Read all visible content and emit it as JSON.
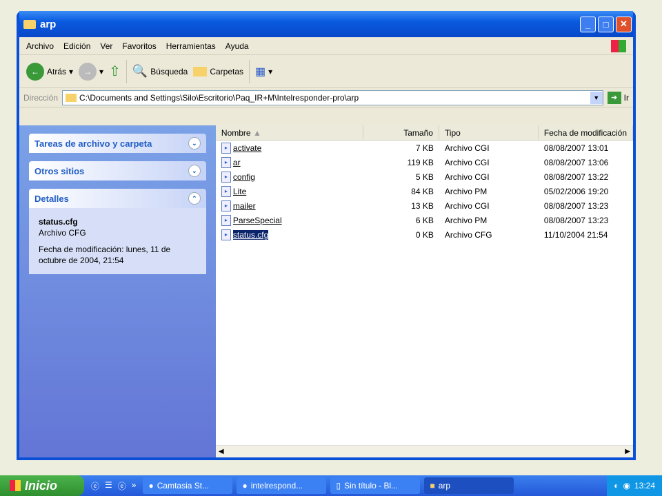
{
  "window": {
    "title": "arp"
  },
  "menu": [
    "Archivo",
    "Edición",
    "Ver",
    "Favoritos",
    "Herramientas",
    "Ayuda"
  ],
  "toolbar": {
    "back": "Atrás",
    "search": "Búsqueda",
    "folders": "Carpetas"
  },
  "address": {
    "label": "Dirección",
    "path": "C:\\Documents and Settings\\Silo\\Escritorio\\Paq_IR+M\\Intelresponder-pro\\arp",
    "go": "Ir"
  },
  "left": {
    "tasks": "Tareas de archivo y carpeta",
    "other": "Otros sitios",
    "details": "Detalles",
    "detail_name": "status.cfg",
    "detail_type": "Archivo CFG",
    "detail_date": "Fecha de modificación: lunes, 11 de octubre de 2004, 21:54"
  },
  "columns": {
    "name": "Nombre",
    "size": "Tamaño",
    "type": "Tipo",
    "date": "Fecha de modificación"
  },
  "files": [
    {
      "name": "activate",
      "size": "7 KB",
      "type": "Archivo CGI",
      "date": "08/08/2007 13:01"
    },
    {
      "name": "ar",
      "size": "119 KB",
      "type": "Archivo CGI",
      "date": "08/08/2007 13:06"
    },
    {
      "name": "config",
      "size": "5 KB",
      "type": "Archivo CGI",
      "date": "08/08/2007 13:22"
    },
    {
      "name": "Lite",
      "size": "84 KB",
      "type": "Archivo PM",
      "date": "05/02/2006 19:20"
    },
    {
      "name": "mailer",
      "size": "13 KB",
      "type": "Archivo CGI",
      "date": "08/08/2007 13:23"
    },
    {
      "name": "ParseSpecial",
      "size": "6 KB",
      "type": "Archivo PM",
      "date": "08/08/2007 13:23"
    },
    {
      "name": "status.cfg",
      "size": "0 KB",
      "type": "Archivo CFG",
      "date": "11/10/2004 21:54"
    }
  ],
  "taskbar": {
    "start": "Inicio",
    "items": [
      "Camtasia St...",
      "intelrespond...",
      "Sin título - Bl...",
      "arp"
    ],
    "clock": "13:24"
  }
}
